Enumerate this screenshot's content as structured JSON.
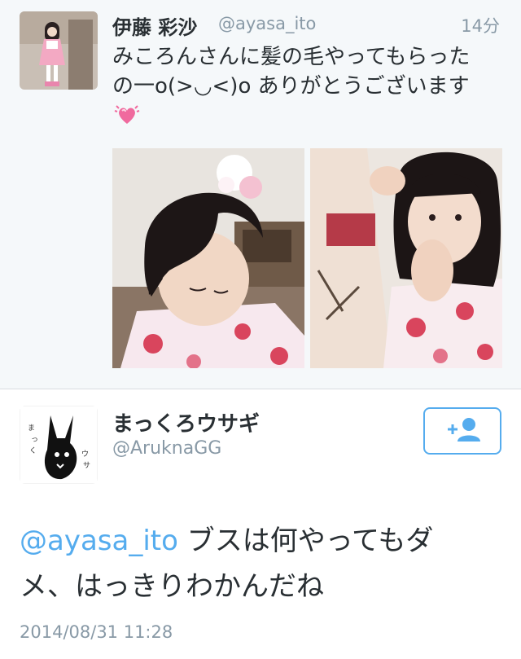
{
  "quoted_tweet": {
    "display_name": "伊藤 彩沙",
    "handle": "@ayasa_ito",
    "time": "14分",
    "text_lines": [
      "みころんさんに髪の毛やってもらった",
      "の一o(>◡<)o ありがとうございます"
    ],
    "emoji": "beating-heart-emoji",
    "photos": [
      "photo-1",
      "photo-2"
    ]
  },
  "tweet": {
    "display_name": "まっくろウサギ",
    "handle": "@AruknaGG",
    "follow_icon": "add-user-icon",
    "mention": "@ayasa_ito",
    "text_line1_rest": " ブスは何やってもダ",
    "text_line2": "メ、はっきりわかんだね",
    "timestamp": "2014/08/31 11:28",
    "avatar_text": "まっくろウサギ"
  },
  "colors": {
    "link": "#55acee",
    "secondary_text": "#8899a6",
    "primary_text": "#292f33",
    "quoted_bg": "#f5f8fa"
  }
}
